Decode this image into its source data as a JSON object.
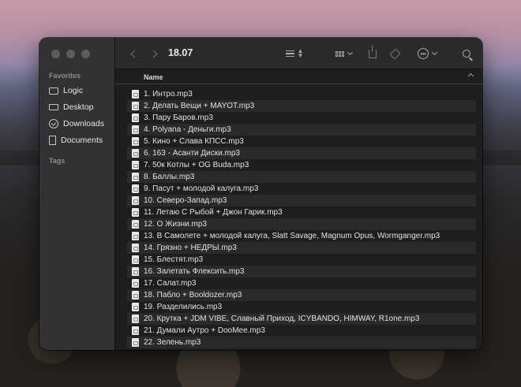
{
  "window": {
    "title": "18.07"
  },
  "sidebar": {
    "favorites_heading": "Favorites",
    "tags_heading": "Tags",
    "items": [
      {
        "label": "Logic",
        "icon": "folder-icon"
      },
      {
        "label": "Desktop",
        "icon": "desktop-icon"
      },
      {
        "label": "Downloads",
        "icon": "download-icon"
      },
      {
        "label": "Documents",
        "icon": "document-icon"
      }
    ]
  },
  "columns": {
    "name": "Name"
  },
  "files": [
    "1. Интро.mp3",
    "2. Делать Вещи + MAYOT.mp3",
    "3. Пару Баров.mp3",
    "4. Polyana - Деньги.mp3",
    "5. Кино + Слава КПСС.mp3",
    "6. 163 - Асанти Диски.mp3",
    "7. 50к Котлы + OG Buda.mp3",
    "8. Баллы.mp3",
    "9. Пасут + молодой калуга.mp3",
    "10. Северо-Запад.mp3",
    "11. Летаю С Рыбой + Джон Гарик.mp3",
    "12. О Жизни.mp3",
    "13. В Самолете + молодой калуга, Slatt Savage, Magnum Opus, Wormganger.mp3",
    "14. Грязно + НЕДРЫ.mp3",
    "15. Блестят.mp3",
    "16. Залетать Флексить.mp3",
    "17. Салат.mp3",
    "18. Пабло + Booldozer.mp3",
    "19. Разделились.mp3",
    "20. Крутка + JDM VIBE, Славный Приход, ICYBANDO, HIMWAY, R1one.mp3",
    "21. Думали Аутро + DooMee.mp3",
    "22. Зелень.mp3"
  ]
}
